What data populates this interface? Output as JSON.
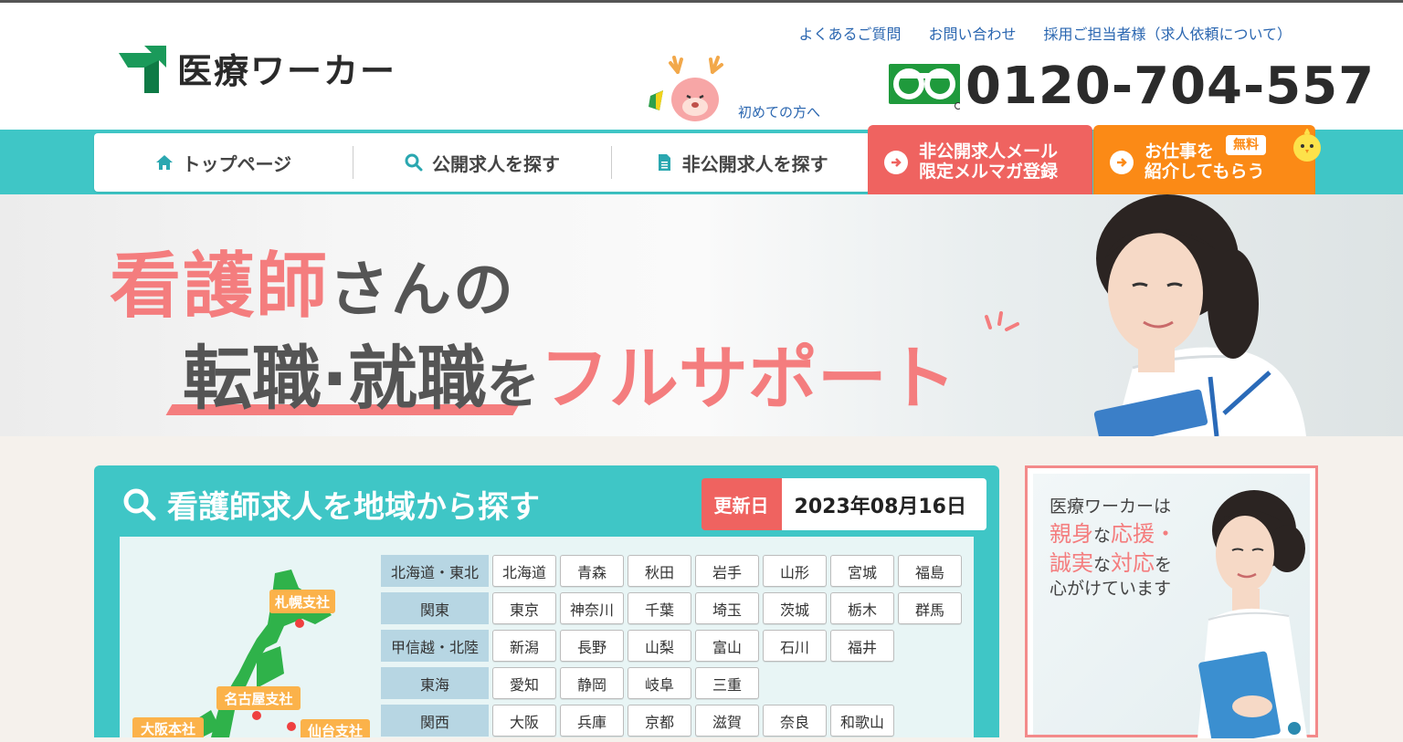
{
  "header": {
    "logo_text": "医療ワーカー",
    "util_links": [
      "よくあるご質問",
      "お問い合わせ",
      "採用ご担当者様（求人依頼について）"
    ],
    "first_time": "初めての方へ",
    "phone": "0120-704-557",
    "icons": [
      "logo-arrow-icon",
      "deer-mascot-icon",
      "freedial-icon"
    ]
  },
  "nav": {
    "items": [
      {
        "label": "トップページ",
        "icon": "home-icon"
      },
      {
        "label": "公開求人を探す",
        "icon": "search-icon"
      },
      {
        "label": "非公開求人を探す",
        "icon": "document-icon"
      }
    ],
    "cta_mail_line1": "非公開求人メール",
    "cta_mail_line2": "限定メルマガ登録",
    "cta_intro_line1": "お仕事を",
    "cta_intro_line2": "紹介してもらう",
    "cta_badge": "無料"
  },
  "hero": {
    "line1_pink": "看護師",
    "line1_gray": "さんの",
    "line2_gray": "転職·就職",
    "line2_small": "を",
    "line2_pink": "フルサポート"
  },
  "search_panel": {
    "title": "看護師求人を地域から探す",
    "update_label": "更新日",
    "update_date": "2023年08月16日",
    "map_labels": [
      "札幌支社",
      "名古屋支社",
      "仙台支社",
      "大阪本社"
    ],
    "regions": [
      {
        "name": "北海道・東北",
        "prefs": [
          "北海道",
          "青森",
          "秋田",
          "岩手",
          "山形",
          "宮城",
          "福島"
        ]
      },
      {
        "name": "関東",
        "prefs": [
          "東京",
          "神奈川",
          "千葉",
          "埼玉",
          "茨城",
          "栃木",
          "群馬"
        ]
      },
      {
        "name": "甲信越・北陸",
        "prefs": [
          "新潟",
          "長野",
          "山梨",
          "富山",
          "石川",
          "福井"
        ]
      },
      {
        "name": "東海",
        "prefs": [
          "愛知",
          "静岡",
          "岐阜",
          "三重"
        ]
      },
      {
        "name": "関西",
        "prefs": [
          "大阪",
          "兵庫",
          "京都",
          "滋賀",
          "奈良",
          "和歌山"
        ]
      }
    ]
  },
  "side_banner": {
    "line1": "医療ワーカーは",
    "line2a": "親身",
    "line2b": "な",
    "line2c": "応援・",
    "line3a": "誠実",
    "line3b": "な",
    "line3c": "対応",
    "line3d": "を",
    "line4": "心がけています"
  },
  "colors": {
    "teal": "#3fc6c6",
    "pink": "#f47d7e",
    "red_cta": "#ef6360",
    "orange_cta": "#fb8a16",
    "link": "#2a66b0"
  }
}
